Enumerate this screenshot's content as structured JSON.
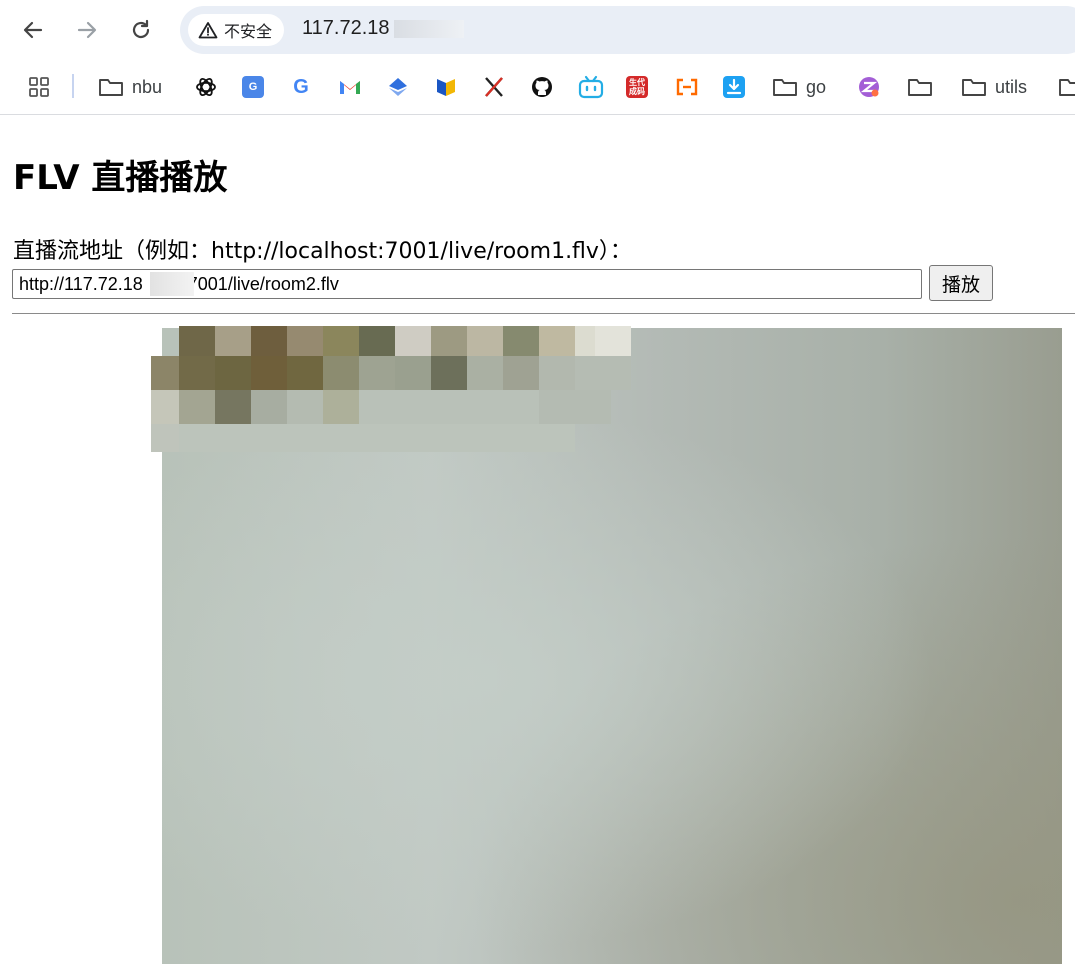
{
  "browser": {
    "security_label": "不安全",
    "url": "117.72.18",
    "bookmarks": [
      {
        "label": "nbu",
        "icon": "folder-icon"
      },
      {
        "label": "",
        "icon": "openai-icon"
      },
      {
        "label": "",
        "icon": "translate-icon"
      },
      {
        "label": "",
        "icon": "google-icon"
      },
      {
        "label": "",
        "icon": "gmail-icon"
      },
      {
        "label": "",
        "icon": "bookmark-app-icon"
      },
      {
        "label": "",
        "icon": "app-icon"
      },
      {
        "label": "",
        "icon": "x-icon"
      },
      {
        "label": "",
        "icon": "github-icon"
      },
      {
        "label": "",
        "icon": "bilibili-icon"
      },
      {
        "label": "",
        "icon": "generator-icon"
      },
      {
        "label": "",
        "icon": "code-icon"
      },
      {
        "label": "",
        "icon": "download-icon"
      },
      {
        "label": "go",
        "icon": "folder-icon"
      },
      {
        "label": "",
        "icon": "zotero-icon"
      },
      {
        "label": "",
        "icon": "folder-icon"
      },
      {
        "label": "utils",
        "icon": "folder-icon"
      }
    ]
  },
  "page": {
    "title": "FLV 直播播放",
    "stream_label": "直播流地址（例如：http://localhost:7001/live/room1.flv）：",
    "stream_url_value": "http://117.72.18        :7001/live/room2.flv",
    "play_button": "播放"
  },
  "colors": {
    "accent_blue": "#1a73e8",
    "omnibox_bg": "#e9eef6"
  }
}
